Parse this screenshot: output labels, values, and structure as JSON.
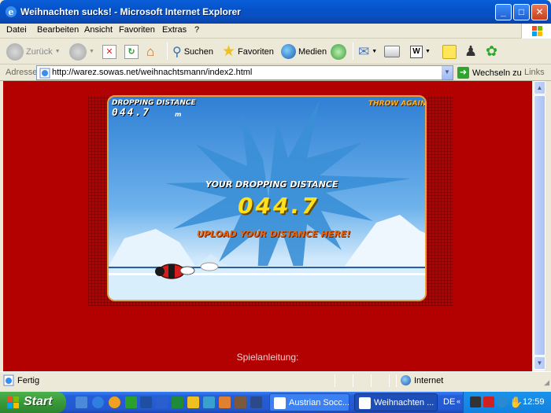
{
  "window": {
    "title": "Weihnachten sucks! - Microsoft Internet Explorer",
    "buttons": {
      "minimize": "_",
      "maximize": "□",
      "close": "✕"
    }
  },
  "menu": [
    "Datei",
    "Bearbeiten",
    "Ansicht",
    "Favoriten",
    "Extras",
    "?"
  ],
  "toolbar": {
    "back": "Zurück",
    "search": "Suchen",
    "favorites": "Favoriten",
    "media": "Medien"
  },
  "address": {
    "label": "Adresse",
    "url": "http://warez.sowas.net/weihnachtsmann/index2.html",
    "go": "Wechseln zu",
    "links": "Links"
  },
  "game": {
    "dropping_distance_label": "DROPPING DISTANCE",
    "dropping_distance_value": "044.7",
    "dropping_distance_unit": "m",
    "throw_again": "THROW AGAIN",
    "your_distance_label": "YOUR DROPPING DISTANCE",
    "your_distance_value": "044.7",
    "upload": "UPLOAD YOUR DISTANCE HERE!"
  },
  "page": {
    "instructions": "Spielanleitung:"
  },
  "status": {
    "text": "Fertig",
    "zone": "Internet"
  },
  "taskbar": {
    "start": "Start",
    "tasks": [
      "Austrian Socc...",
      "Weihnachten ..."
    ],
    "lang": "DE",
    "clock": "12:59"
  },
  "colors": {
    "page_background": "#b30000",
    "title_blue": "#0553c9",
    "taskbar_blue": "#245edb",
    "start_green": "#389a38",
    "distance_yellow": "#ffe01a",
    "upload_orange": "#e86a10"
  }
}
